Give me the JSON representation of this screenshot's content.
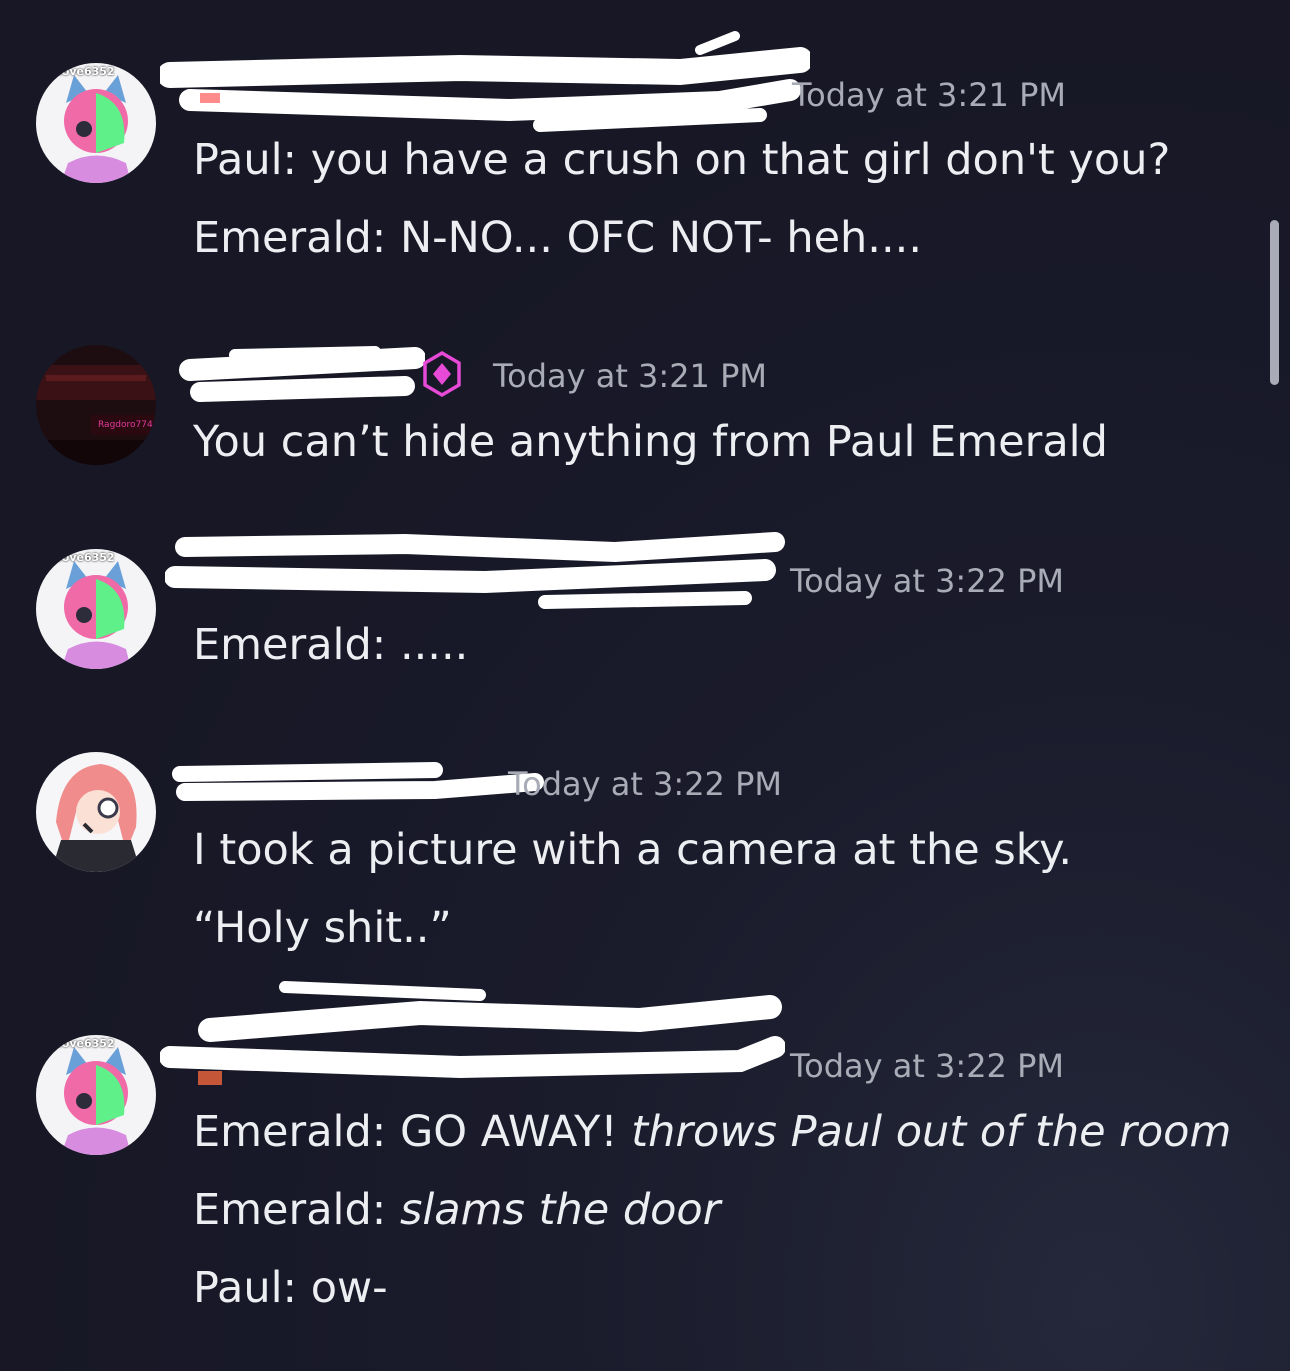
{
  "messages": [
    {
      "avatar": "emerald-avatar",
      "avatar_badge": "iove6352",
      "timestamp": "Today at 3:21 PM",
      "lines": [
        {
          "text": "Paul: you have a crush on that girl don't you?"
        },
        {
          "text": "Emerald: N-NO... OFC NOT- heh...."
        }
      ]
    },
    {
      "avatar": "dark-room-avatar",
      "avatar_badge": "Ragdoro774",
      "role_icon": "hexagon-badge-icon",
      "timestamp": "Today at 3:21 PM",
      "lines": [
        {
          "text": "You can’t hide anything from Paul Emerald"
        }
      ]
    },
    {
      "avatar": "emerald-avatar",
      "avatar_badge": "iove6352",
      "timestamp": "Today at 3:22 PM",
      "lines": [
        {
          "text": "Emerald: ....."
        }
      ]
    },
    {
      "avatar": "pink-hair-avatar",
      "timestamp": "Today at 3:22 PM",
      "lines": [
        {
          "text": "I took a picture with a camera at the sky."
        },
        {
          "text": "“Holy shit..”"
        }
      ]
    },
    {
      "avatar": "emerald-avatar",
      "avatar_badge": "iove6352",
      "timestamp": "Today at 3:22 PM",
      "lines": [
        {
          "prefix": "Emerald: GO AWAY! ",
          "action": "throws Paul out of the room"
        },
        {
          "prefix": "Emerald: ",
          "action": "slams the door"
        },
        {
          "text": "Paul: ow-"
        }
      ]
    }
  ],
  "colors": {
    "background": "#171726",
    "message_text": "#eceef2",
    "timestamp": "#a9acb6",
    "redaction": "#ffffff",
    "role_icon": "#e64ad6"
  }
}
